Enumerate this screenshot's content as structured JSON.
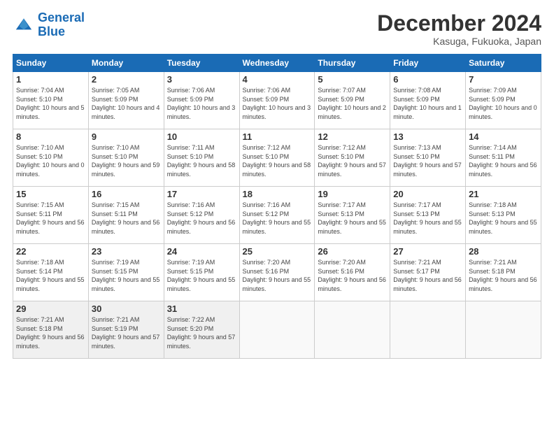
{
  "logo": {
    "line1": "General",
    "line2": "Blue"
  },
  "header": {
    "month": "December 2024",
    "location": "Kasuga, Fukuoka, Japan"
  },
  "weekdays": [
    "Sunday",
    "Monday",
    "Tuesday",
    "Wednesday",
    "Thursday",
    "Friday",
    "Saturday"
  ],
  "weeks": [
    [
      {
        "day": "1",
        "sunrise": "7:04 AM",
        "sunset": "5:10 PM",
        "daylight": "10 hours and 5 minutes."
      },
      {
        "day": "2",
        "sunrise": "7:05 AM",
        "sunset": "5:09 PM",
        "daylight": "10 hours and 4 minutes."
      },
      {
        "day": "3",
        "sunrise": "7:06 AM",
        "sunset": "5:09 PM",
        "daylight": "10 hours and 3 minutes."
      },
      {
        "day": "4",
        "sunrise": "7:06 AM",
        "sunset": "5:09 PM",
        "daylight": "10 hours and 3 minutes."
      },
      {
        "day": "5",
        "sunrise": "7:07 AM",
        "sunset": "5:09 PM",
        "daylight": "10 hours and 2 minutes."
      },
      {
        "day": "6",
        "sunrise": "7:08 AM",
        "sunset": "5:09 PM",
        "daylight": "10 hours and 1 minute."
      },
      {
        "day": "7",
        "sunrise": "7:09 AM",
        "sunset": "5:09 PM",
        "daylight": "10 hours and 0 minutes."
      }
    ],
    [
      {
        "day": "8",
        "sunrise": "7:10 AM",
        "sunset": "5:10 PM",
        "daylight": "10 hours and 0 minutes."
      },
      {
        "day": "9",
        "sunrise": "7:10 AM",
        "sunset": "5:10 PM",
        "daylight": "9 hours and 59 minutes."
      },
      {
        "day": "10",
        "sunrise": "7:11 AM",
        "sunset": "5:10 PM",
        "daylight": "9 hours and 58 minutes."
      },
      {
        "day": "11",
        "sunrise": "7:12 AM",
        "sunset": "5:10 PM",
        "daylight": "9 hours and 58 minutes."
      },
      {
        "day": "12",
        "sunrise": "7:12 AM",
        "sunset": "5:10 PM",
        "daylight": "9 hours and 57 minutes."
      },
      {
        "day": "13",
        "sunrise": "7:13 AM",
        "sunset": "5:10 PM",
        "daylight": "9 hours and 57 minutes."
      },
      {
        "day": "14",
        "sunrise": "7:14 AM",
        "sunset": "5:11 PM",
        "daylight": "9 hours and 56 minutes."
      }
    ],
    [
      {
        "day": "15",
        "sunrise": "7:15 AM",
        "sunset": "5:11 PM",
        "daylight": "9 hours and 56 minutes."
      },
      {
        "day": "16",
        "sunrise": "7:15 AM",
        "sunset": "5:11 PM",
        "daylight": "9 hours and 56 minutes."
      },
      {
        "day": "17",
        "sunrise": "7:16 AM",
        "sunset": "5:12 PM",
        "daylight": "9 hours and 56 minutes."
      },
      {
        "day": "18",
        "sunrise": "7:16 AM",
        "sunset": "5:12 PM",
        "daylight": "9 hours and 55 minutes."
      },
      {
        "day": "19",
        "sunrise": "7:17 AM",
        "sunset": "5:13 PM",
        "daylight": "9 hours and 55 minutes."
      },
      {
        "day": "20",
        "sunrise": "7:17 AM",
        "sunset": "5:13 PM",
        "daylight": "9 hours and 55 minutes."
      },
      {
        "day": "21",
        "sunrise": "7:18 AM",
        "sunset": "5:13 PM",
        "daylight": "9 hours and 55 minutes."
      }
    ],
    [
      {
        "day": "22",
        "sunrise": "7:18 AM",
        "sunset": "5:14 PM",
        "daylight": "9 hours and 55 minutes."
      },
      {
        "day": "23",
        "sunrise": "7:19 AM",
        "sunset": "5:15 PM",
        "daylight": "9 hours and 55 minutes."
      },
      {
        "day": "24",
        "sunrise": "7:19 AM",
        "sunset": "5:15 PM",
        "daylight": "9 hours and 55 minutes."
      },
      {
        "day": "25",
        "sunrise": "7:20 AM",
        "sunset": "5:16 PM",
        "daylight": "9 hours and 55 minutes."
      },
      {
        "day": "26",
        "sunrise": "7:20 AM",
        "sunset": "5:16 PM",
        "daylight": "9 hours and 56 minutes."
      },
      {
        "day": "27",
        "sunrise": "7:21 AM",
        "sunset": "5:17 PM",
        "daylight": "9 hours and 56 minutes."
      },
      {
        "day": "28",
        "sunrise": "7:21 AM",
        "sunset": "5:18 PM",
        "daylight": "9 hours and 56 minutes."
      }
    ],
    [
      {
        "day": "29",
        "sunrise": "7:21 AM",
        "sunset": "5:18 PM",
        "daylight": "9 hours and 56 minutes."
      },
      {
        "day": "30",
        "sunrise": "7:21 AM",
        "sunset": "5:19 PM",
        "daylight": "9 hours and 57 minutes."
      },
      {
        "day": "31",
        "sunrise": "7:22 AM",
        "sunset": "5:20 PM",
        "daylight": "9 hours and 57 minutes."
      },
      null,
      null,
      null,
      null
    ]
  ]
}
